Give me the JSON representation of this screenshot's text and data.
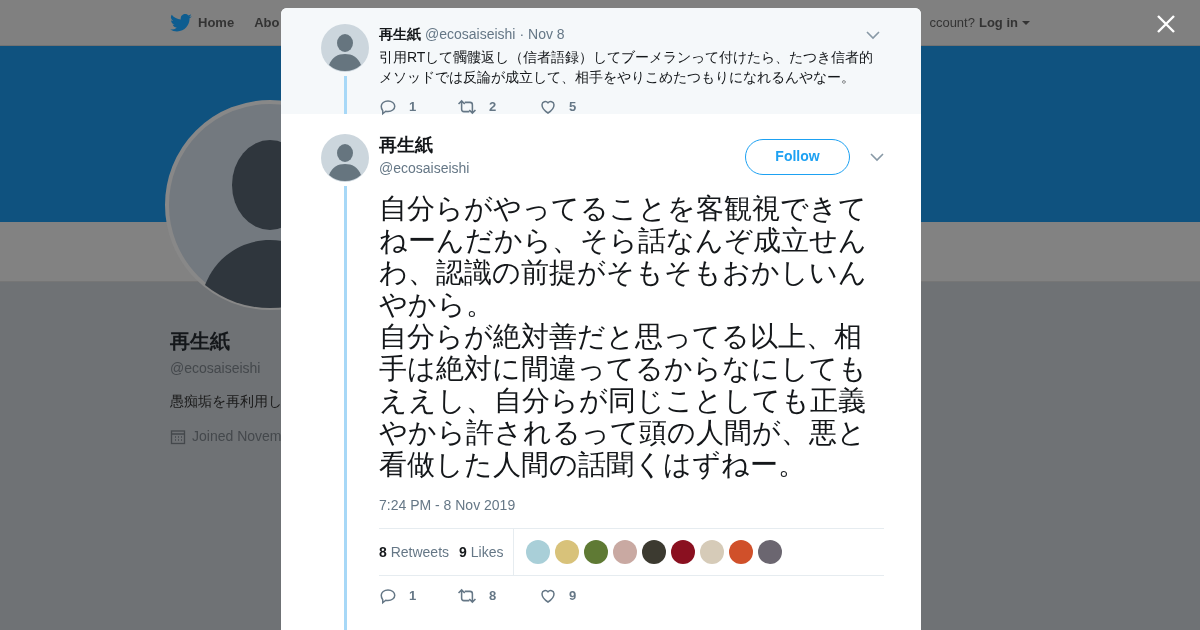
{
  "nav": {
    "items": [
      "Home",
      "Abo"
    ],
    "account_prompt": "ccount?",
    "login": "Log in"
  },
  "profile": {
    "name": "再生紙",
    "handle": "@ecosaiseishi",
    "bio": "愚痴垢を再利用し",
    "joined": "Joined Novem"
  },
  "modal": {
    "parent_tweet": {
      "name": "再生紙",
      "handle": "@ecosaiseishi",
      "time": "· Nov 8",
      "text": "引用RTして髑髏返し（信者語録）してブーメランって付けたら、たつき信者的メソッドでは反論が成立して、相手をやりこめたつもりになれるんやなー。",
      "replies": "1",
      "retweets": "2",
      "likes": "5"
    },
    "tweet": {
      "name": "再生紙",
      "handle": "@ecosaiseishi",
      "follow": "Follow",
      "paragraphs": [
        "自分らがやってることを客観視できてねーんだから、そら話なんぞ成立せんわ、認識の前提がそもそもおかしいんやから。",
        "自分らが絶対善だと思ってる以上、相手は絶対に間違ってるからなにしてもええし、自分らが同じことしても正義やから許されるって頭の人間が、悪と看做した人間の話聞くはずねー。"
      ],
      "timestamp": "7:24 PM - 8 Nov 2019",
      "retweet_count": "8",
      "retweet_label": "Retweets",
      "like_count": "9",
      "like_label": "Likes",
      "liked_by": [
        {
          "color": "#a9cfd8"
        },
        {
          "color": "#d8c27a"
        },
        {
          "color": "#5f7a34"
        },
        {
          "color": "#c9a9a2"
        },
        {
          "color": "#3c3a30"
        },
        {
          "color": "#8a1020"
        },
        {
          "color": "#d6cbb8"
        },
        {
          "color": "#d0502a"
        },
        {
          "color": "#6b6670"
        }
      ],
      "replies": "1",
      "retweets": "8",
      "likes": "9"
    }
  }
}
